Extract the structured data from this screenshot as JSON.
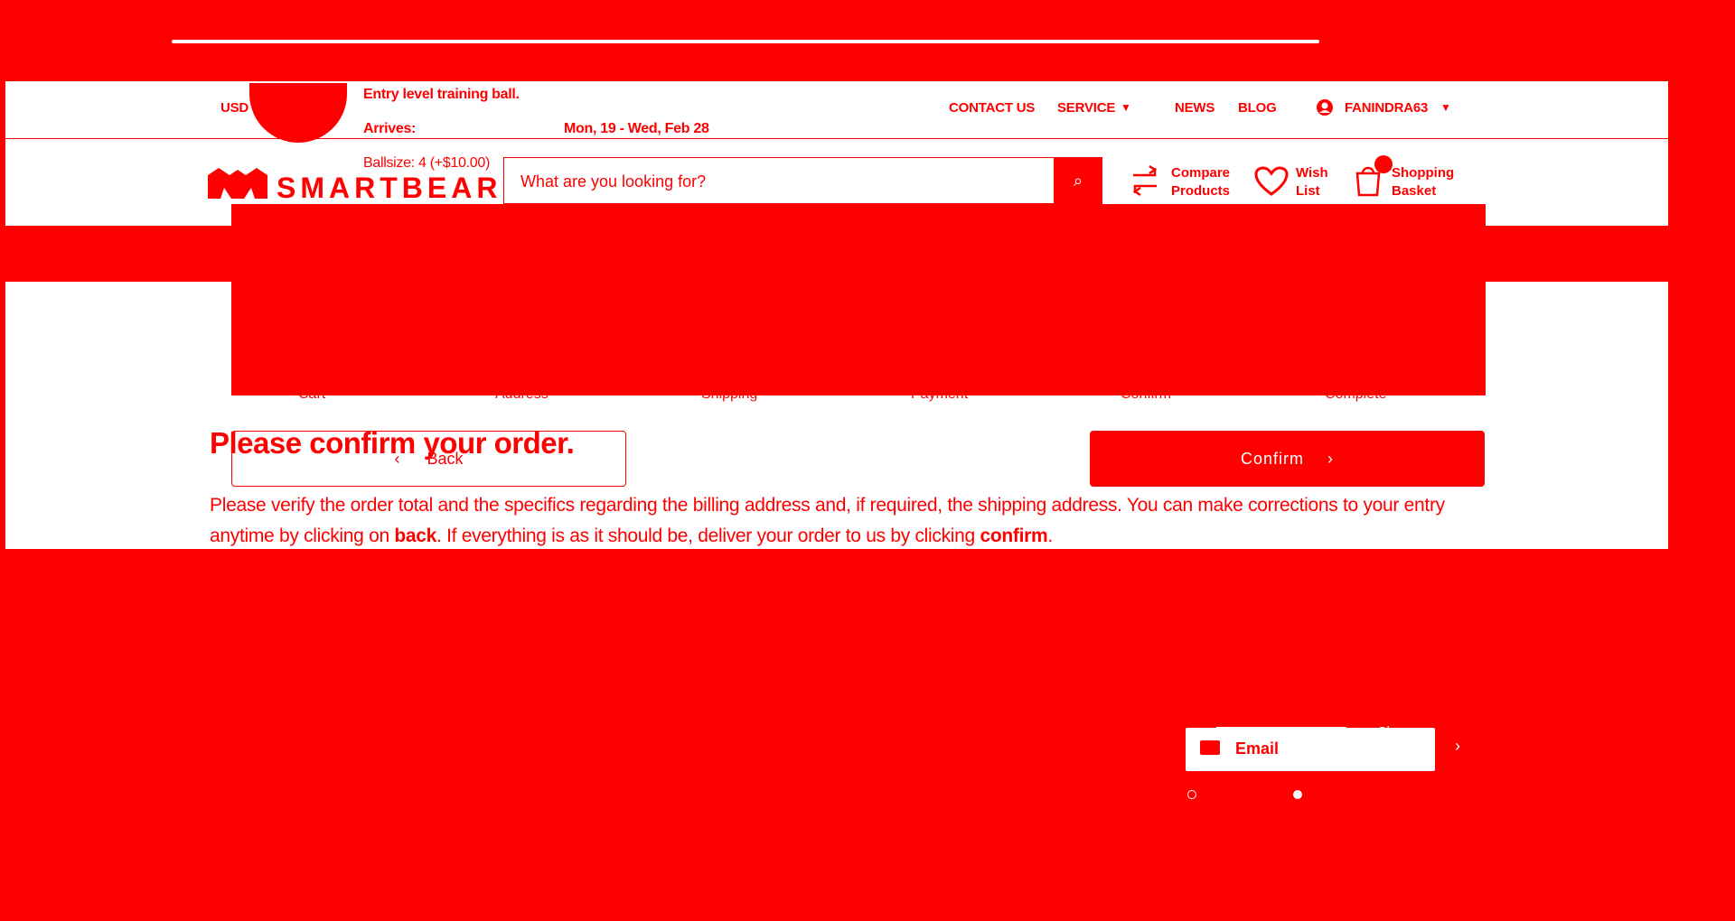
{
  "colors": {
    "brand": "#ff0000",
    "surface": "#ffffff"
  },
  "utility_bar": {
    "currency": "USD",
    "links": [
      "CONTACT US",
      "SERVICE",
      "NEWS",
      "BLOG"
    ],
    "user": "FANINDRA63"
  },
  "header": {
    "logo_text": "SMARTBEAR.",
    "search_placeholder": "What are you looking for?",
    "actions": {
      "compare_line1": "Compare",
      "compare_line2": "Products",
      "wish_line1": "Wish",
      "wish_line2": "List",
      "basket_line1": "Shopping",
      "basket_line2": "Basket"
    },
    "icons": {
      "compare": "compare-icon",
      "wish": "heart-icon",
      "basket": "shopping-bag-icon",
      "search": "search-icon",
      "user": "user-icon",
      "chevron": "chevron-down-icon"
    }
  },
  "cart_popup": {
    "description": "Entry level training ball.",
    "arrives_label": "Arrives:",
    "arrives_value": "Mon, 19 - Wed, Feb 28",
    "option": "Ballsize: 4 (+$10.00)"
  },
  "checkout": {
    "steps": [
      "Cart",
      "Address",
      "Shipping",
      "Payment",
      "Confirm",
      "Complete"
    ],
    "title": "Please confirm your order.",
    "back_label": "Back",
    "confirm_label": "Confirm",
    "desc_part1": "Please verify the order total and the specifics regarding the billing address and, if required, the shipping address. You can make corrections to your entry anytime by clicking on ",
    "desc_back": "back",
    "desc_part2": ". If everything is as it should be, deliver your order to us by clicking ",
    "desc_confirm": "confirm",
    "desc_part3": "."
  },
  "contact_widget": {
    "email_label": "Email",
    "change_label": "Change"
  }
}
